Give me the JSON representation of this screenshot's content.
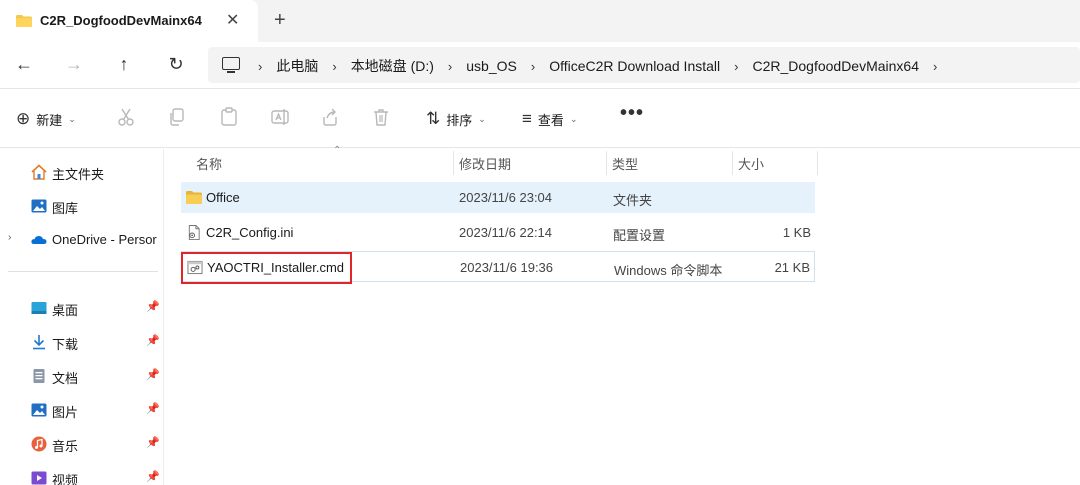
{
  "tab": {
    "title": "C2R_DogfoodDevMainx64",
    "close_glyph": "✕",
    "new_tab_glyph": "+"
  },
  "nav": {
    "back": "←",
    "forward": "→",
    "up": "↑",
    "refresh": "↻"
  },
  "breadcrumb": {
    "separator": "›",
    "end_chevron": "›",
    "segments": [
      "此电脑",
      "本地磁盘 (D:)",
      "usb_OS",
      "OfficeC2R Download Install",
      "C2R_DogfoodDevMainx64"
    ]
  },
  "toolbar": {
    "new_label": "新建",
    "new_glyph": "⊕",
    "sort_label": "排序",
    "sort_glyph": "⇅",
    "view_label": "查看",
    "view_glyph": "≡",
    "caret": "⌄",
    "more": "•••",
    "tools": [
      "cut-icon",
      "copy-icon",
      "paste-icon",
      "rename-icon",
      "share-icon",
      "delete-icon"
    ]
  },
  "sidebar": {
    "items": [
      {
        "label": "主文件夹",
        "icon": "home-icon"
      },
      {
        "label": "图库",
        "icon": "gallery-icon"
      },
      {
        "label": "OneDrive - Persor",
        "icon": "onedrive-icon",
        "expander": "›"
      }
    ],
    "pinned": [
      {
        "label": "桌面",
        "icon": "desktop-icon"
      },
      {
        "label": "下载",
        "icon": "download-icon"
      },
      {
        "label": "文档",
        "icon": "documents-icon"
      },
      {
        "label": "图片",
        "icon": "pictures-icon"
      },
      {
        "label": "音乐",
        "icon": "music-icon"
      },
      {
        "label": "视频",
        "icon": "videos-icon"
      }
    ],
    "pin_glyph": "📌"
  },
  "columns": {
    "name": "名称",
    "modified": "修改日期",
    "type": "类型",
    "size": "大小",
    "sort_glyph": "⌃"
  },
  "files": [
    {
      "name": "Office",
      "modified": "2023/11/6 23:04",
      "type": "文件夹",
      "size": "",
      "icon": "folder-icon"
    },
    {
      "name": "C2R_Config.ini",
      "modified": "2023/11/6 22:14",
      "type": "配置设置",
      "size": "1 KB",
      "icon": "config-file-icon"
    },
    {
      "name": "YAOCTRI_Installer.cmd",
      "modified": "2023/11/6 19:36",
      "type": "Windows 命令脚本",
      "size": "21 KB",
      "icon": "cmd-file-icon"
    }
  ],
  "colors": {
    "accent": "#0078d4",
    "selection": "#e5f1fb",
    "highlight": "#e0262b",
    "folder": "#f2c94c"
  }
}
